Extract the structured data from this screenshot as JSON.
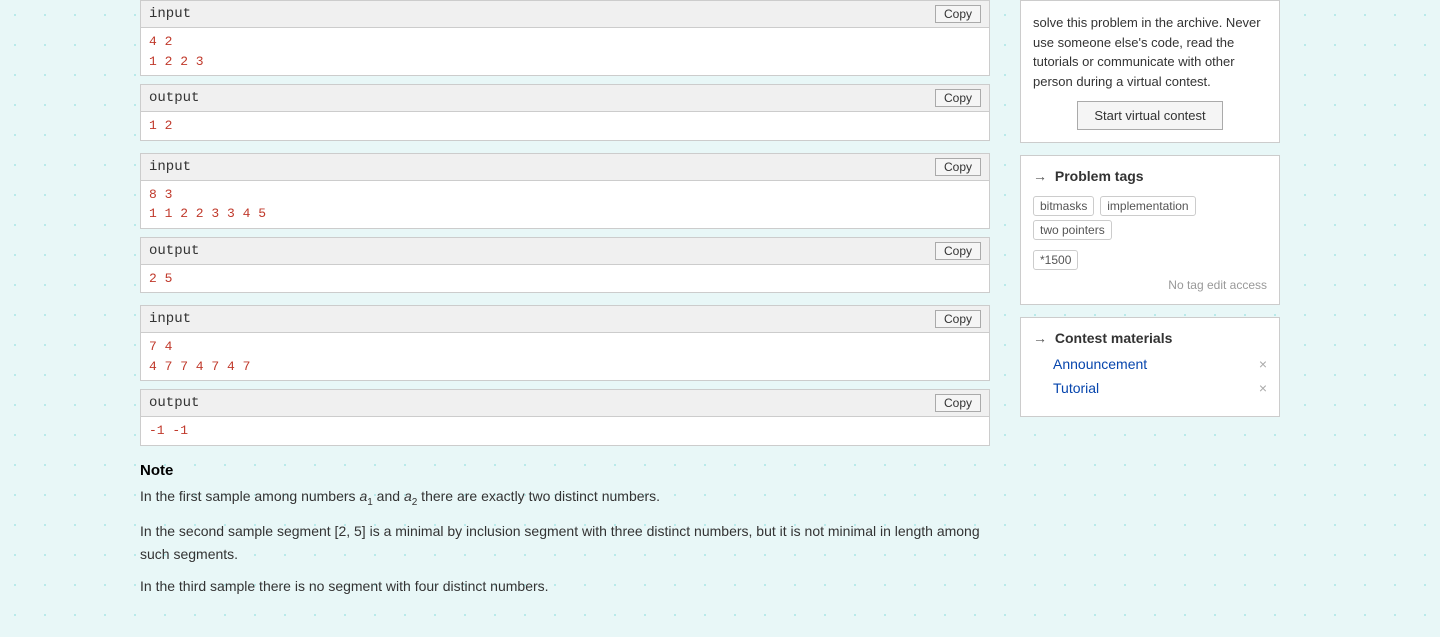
{
  "main": {
    "blocks": [
      {
        "id": "block1",
        "input_label": "input",
        "input_content_line1": "4 2",
        "input_content_line2": "1 2 2 3",
        "output_label": "output",
        "output_content": "1 2"
      },
      {
        "id": "block2",
        "input_label": "input",
        "input_content_line1": "8 3",
        "input_content_line2": "1 1 2 2 3 3 4 5",
        "output_label": "output",
        "output_content": "2 5"
      },
      {
        "id": "block3",
        "input_label": "input",
        "input_content_line1": "7 4",
        "input_content_line2": "4 7 7 4 7 4 7",
        "output_label": "output",
        "output_content": "-1 -1"
      }
    ],
    "copy_label": "Copy",
    "note": {
      "title": "Note",
      "paragraphs": [
        "In the first sample among numbers a1 and a2 there are exactly two distinct numbers.",
        "In the second sample segment [2, 5] is a minimal by inclusion segment with three distinct numbers, but it is not minimal in length among such segments.",
        "In the third sample there is no segment with four distinct numbers."
      ]
    }
  },
  "sidebar": {
    "disclaimer": "solve this problem in the archive. Never use someone else's code, read the tutorials or communicate with other person during a virtual contest.",
    "virtual_contest_btn": "Start virtual contest",
    "problem_tags": {
      "title": "Problem tags",
      "tags": [
        "bitmasks",
        "implementation",
        "two pointers",
        "*1500"
      ],
      "no_tag_edit": "No tag edit access"
    },
    "contest_materials": {
      "title": "Contest materials",
      "items": [
        "Announcement",
        "Tutorial"
      ]
    }
  }
}
